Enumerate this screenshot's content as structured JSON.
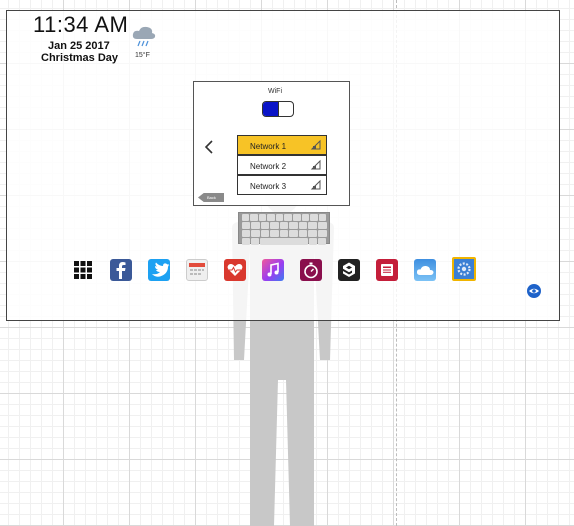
{
  "status": {
    "time": "11:34 AM",
    "date": "Jan 25 2017",
    "holiday": "Christmas Day",
    "weather_icon": "rain-cloud-icon",
    "temperature": "15°F"
  },
  "wifi": {
    "label": "WiFi",
    "enabled": true,
    "networks": [
      {
        "name": "Network 1",
        "selected": true
      },
      {
        "name": "Network 2",
        "selected": false
      },
      {
        "name": "Network 3",
        "selected": false
      }
    ],
    "back_label": "Back"
  },
  "dock": {
    "apps": [
      {
        "name": "apps-grid-icon",
        "color": "#111111"
      },
      {
        "name": "facebook-icon",
        "color": "#3b5998"
      },
      {
        "name": "twitter-icon",
        "color": "#1da1f2"
      },
      {
        "name": "calendar-icon",
        "color": "#e0e0e0"
      },
      {
        "name": "health-icon",
        "color": "#d9382e"
      },
      {
        "name": "music-icon",
        "color": "#c02bd6"
      },
      {
        "name": "timer-icon",
        "color": "#8a0f4d"
      },
      {
        "name": "nine-gag-icon",
        "color": "#222222"
      },
      {
        "name": "news-icon",
        "color": "#c41e3a"
      },
      {
        "name": "weather-app-icon",
        "color": "#4aa3e8"
      },
      {
        "name": "settings-icon",
        "color": "#3b7fd4",
        "highlighted": true
      }
    ]
  },
  "colors": {
    "selected_network": "#f7c326",
    "toggle_on": "#0a14c8",
    "highlight_border": "#f0b400"
  }
}
